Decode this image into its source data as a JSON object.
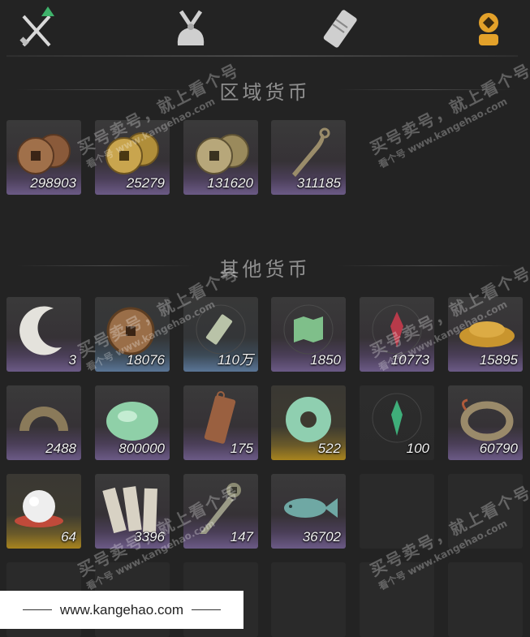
{
  "tabs": [
    {
      "name": "weapons-tab-icon"
    },
    {
      "name": "bundle-tab-icon"
    },
    {
      "name": "scroll-tab-icon"
    },
    {
      "name": "currency-tab-icon"
    }
  ],
  "sections": {
    "regional": "区域货币",
    "other": "其他货币"
  },
  "regional_items": [
    {
      "qty": "298903",
      "icon": "bronze-coins-icon"
    },
    {
      "qty": "25279",
      "icon": "gold-coins-icon"
    },
    {
      "qty": "131620",
      "icon": "silver-coins-icon"
    },
    {
      "qty": "311185",
      "icon": "blade-token-icon"
    }
  ],
  "other_items": [
    {
      "qty": "3",
      "icon": "moon-jade-icon"
    },
    {
      "qty": "18076",
      "icon": "copper-coin-icon"
    },
    {
      "qty": "110万",
      "icon": "jade-tablet-icon"
    },
    {
      "qty": "1850",
      "icon": "map-icon"
    },
    {
      "qty": "10773",
      "icon": "red-emblem-icon"
    },
    {
      "qty": "15895",
      "icon": "grain-pile-icon"
    },
    {
      "qty": "2488",
      "icon": "half-coin-icon"
    },
    {
      "qty": "800000",
      "icon": "jade-stone-icon"
    },
    {
      "qty": "175",
      "icon": "bronze-plaque-icon"
    },
    {
      "qty": "522",
      "icon": "jade-disc-icon"
    },
    {
      "qty": "100",
      "icon": "green-emblem-icon"
    },
    {
      "qty": "60790",
      "icon": "coin-string-icon"
    },
    {
      "qty": "64",
      "icon": "pearl-icon"
    },
    {
      "qty": "3396",
      "icon": "paper-notes-icon"
    },
    {
      "qty": "147",
      "icon": "knife-coin-icon"
    },
    {
      "qty": "36702",
      "icon": "jade-fish-icon"
    }
  ],
  "watermark": {
    "line1": "买号卖号，就上看个号",
    "line2": "看个号  www.kangehao.com"
  },
  "footer": {
    "url": "www.kangehao.com"
  }
}
